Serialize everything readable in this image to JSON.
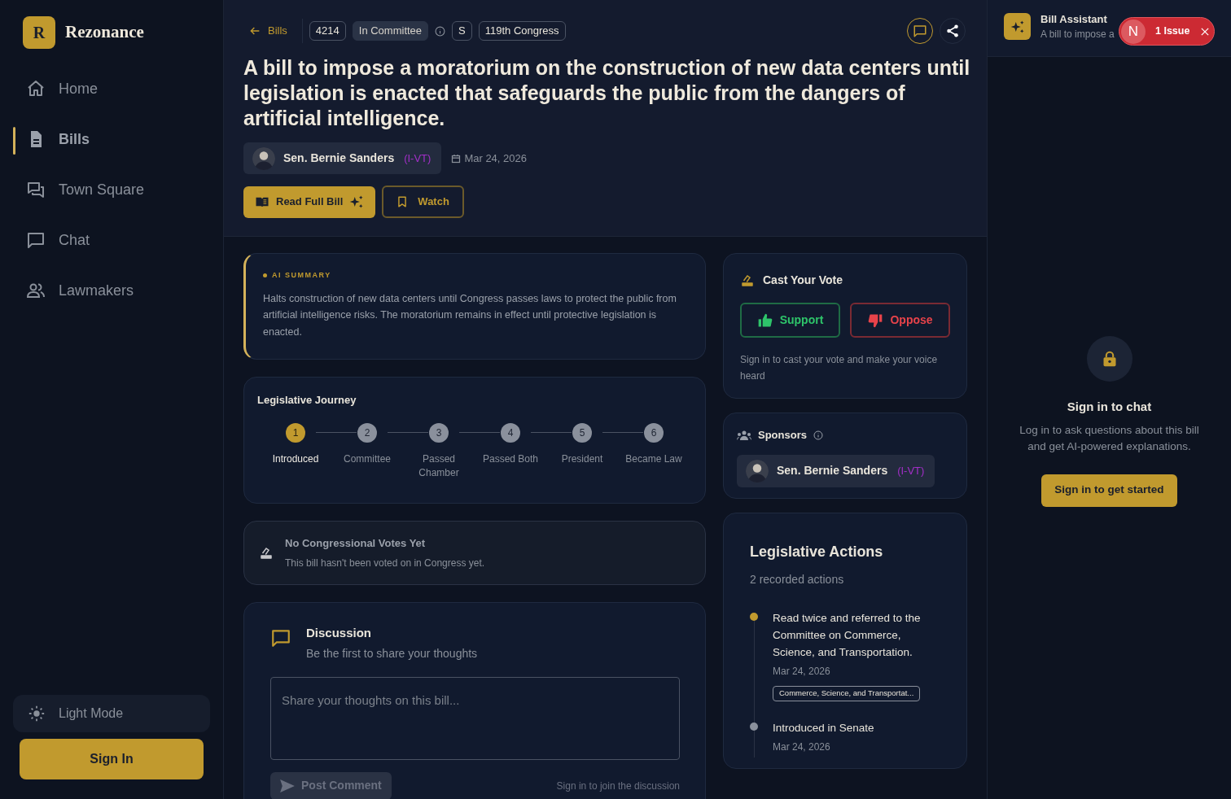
{
  "sidebar": {
    "logo_letter": "R",
    "brand": "Rezonance",
    "items": [
      {
        "label": "Home",
        "selected": false
      },
      {
        "label": "Bills",
        "selected": true
      },
      {
        "label": "Town Square",
        "selected": false
      },
      {
        "label": "Chat",
        "selected": false
      },
      {
        "label": "Lawmakers",
        "selected": false
      }
    ],
    "theme_toggle": "Light Mode",
    "sign_in": "Sign In"
  },
  "header": {
    "back": "Bills",
    "badges": [
      {
        "text": "4214",
        "kind": "outline"
      },
      {
        "text": "In Committee",
        "kind": "status"
      },
      {
        "text": "S",
        "kind": "outline"
      },
      {
        "text": "119th Congress",
        "kind": "outline"
      }
    ],
    "title": "A bill to impose a moratorium on the construction of new data centers until legislation is enacted that safeguards the public from the dangers of artificial intelligence.",
    "sponsor": {
      "name": "Sen. Bernie Sanders",
      "party": "(I-VT)"
    },
    "date": "Mar 24, 2026",
    "read_button": "Read Full Bill",
    "watch_button": "Watch"
  },
  "ai_summary": {
    "label": "AI SUMMARY",
    "text": "Halts construction of new data centers until Congress passes laws to protect the public from artificial intelligence risks. The moratorium remains in effect until protective legislation is enacted."
  },
  "journey": {
    "title": "Legislative Journey",
    "steps": [
      {
        "number": "1",
        "label": "Introduced",
        "selected": true
      },
      {
        "number": "2",
        "label": "Committee",
        "selected": false
      },
      {
        "number": "3",
        "label": "Passed Chamber",
        "selected": false
      },
      {
        "number": "4",
        "label": "Passed Both",
        "selected": false
      },
      {
        "number": "5",
        "label": "President",
        "selected": false
      },
      {
        "number": "6",
        "label": "Became Law",
        "selected": false
      }
    ]
  },
  "congress_votes": {
    "title": "No Congressional Votes Yet",
    "text": "This bill hasn't been voted on in Congress yet."
  },
  "discussion": {
    "title": "Discussion",
    "subtitle": "Be the first to share your thoughts",
    "placeholder": "Share your thoughts on this bill...",
    "post_button": "Post Comment",
    "note": "Sign in to join the discussion"
  },
  "vote": {
    "title": "Cast Your Vote",
    "support": "Support",
    "oppose": "Oppose",
    "note": "Sign in to cast your vote and make your voice heard"
  },
  "sponsors": {
    "title": "Sponsors",
    "items": [
      {
        "name": "Sen. Bernie Sanders",
        "party": "(I-VT)"
      }
    ]
  },
  "actions": {
    "title": "Legislative Actions",
    "count": "2 recorded actions",
    "items": [
      {
        "text": "Read twice and referred to the Committee on Commerce, Science, and Transportation.",
        "date": "Mar 24, 2026",
        "tag": "Commerce, Science, and Transportat...",
        "latest": true
      },
      {
        "text": "Introduced in Senate",
        "date": "Mar 24, 2026",
        "latest": false
      }
    ]
  },
  "assistant": {
    "title": "Bill Assistant",
    "subtitle": "A bill to impose a",
    "heading": "Sign in to chat",
    "text": "Log in to ask questions about this bill and get AI-powered explanations.",
    "button": "Sign in to get started"
  },
  "dev_badge": {
    "letter": "N",
    "text": "1 Issue"
  }
}
